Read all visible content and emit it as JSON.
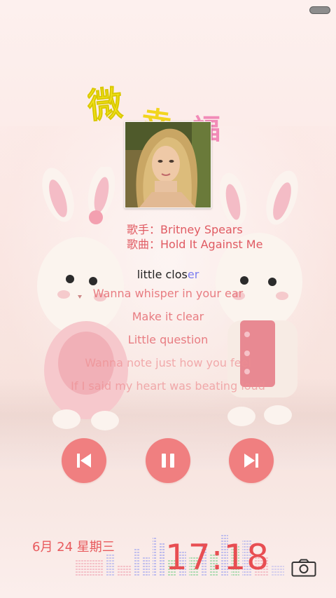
{
  "song": {
    "artist_label": "歌手：",
    "artist": "Britney Spears",
    "title_label": "歌曲：",
    "title": "Hold It Against Me"
  },
  "lyrics": {
    "current_pre": "little clos",
    "current_hl": "er",
    "next": [
      "Wanna whisper in your ear",
      "Make it clear",
      "Little question",
      "Wanna note just how you feel",
      "If I said my heart was beating loud"
    ]
  },
  "controls": {
    "prev": "previous",
    "pause": "pause",
    "next": "next"
  },
  "lockscreen": {
    "date": "6月 24 星期三",
    "time": "17:18"
  },
  "colors": {
    "accent": "#f07f80",
    "lyric": "#e7767c",
    "highlight": "#7b7df0"
  }
}
